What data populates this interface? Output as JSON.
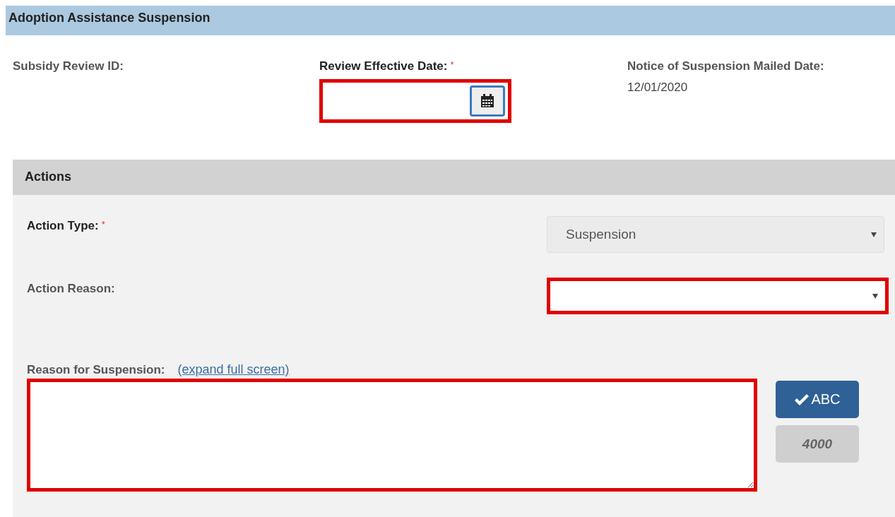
{
  "header": {
    "title": "Adoption Assistance Suspension"
  },
  "fields": [
    {
      "kind": "text",
      "label": "Subsidy Review ID:"
    },
    {
      "kind": "date",
      "label": "Review Effective Date:",
      "required_mark": "*",
      "highlighted": true
    },
    {
      "kind": "text",
      "label": "Notice of Suspension Mailed Date:",
      "value": "12/01/2020"
    }
  ],
  "actions": {
    "title": "Actions",
    "rows": [
      {
        "label": "Action Type:",
        "required_mark": "*",
        "value": "Suspension",
        "disabled": true,
        "highlighted": false
      },
      {
        "label": "Action Reason:",
        "disabled": false,
        "highlighted": true
      }
    ],
    "reason": {
      "label": "Reason for Suspension:",
      "link": "(expand full screen)",
      "highlighted": true,
      "spellcheck_button": "ABC",
      "char_count": "4000"
    }
  }
}
